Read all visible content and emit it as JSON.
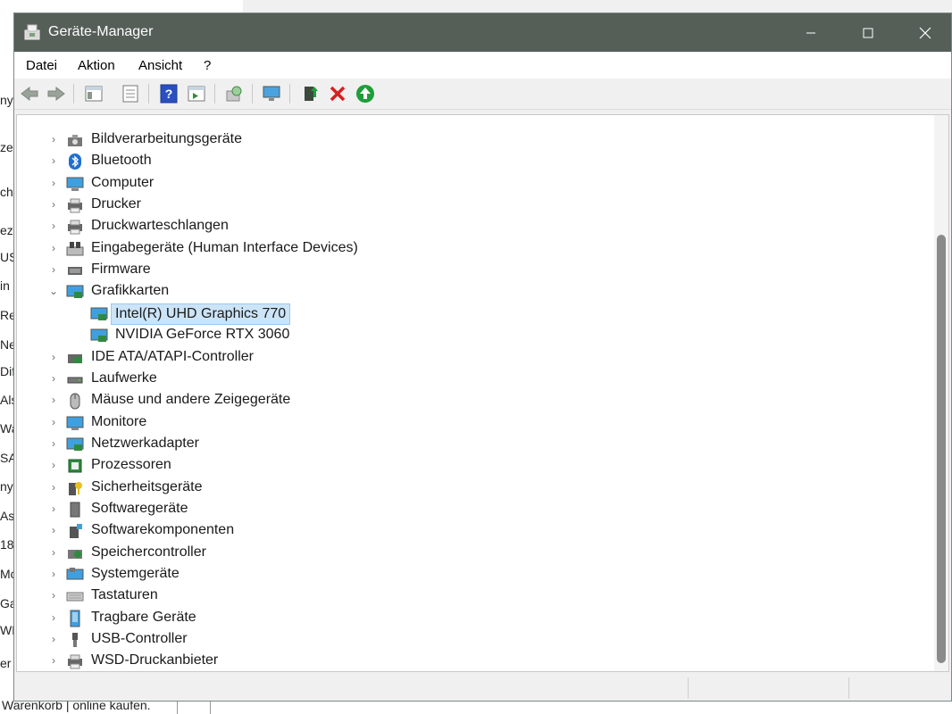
{
  "background": {
    "left_fragments": [
      "ny",
      "ze",
      "ch",
      "eze",
      "US",
      "in",
      "Rev",
      "Ne",
      "Dif",
      "Als",
      "Wai",
      "SA",
      "ny",
      "Ast",
      "18",
      "Mc",
      "Gar",
      "WD",
      "er"
    ],
    "bottom_text": "Warenkorb | online kaufen."
  },
  "window": {
    "title": "Geräte-Manager",
    "controls": {
      "minimize": "—",
      "maximize": "☐",
      "close": "✕"
    }
  },
  "menu": [
    "Datei",
    "Aktion",
    "Ansicht",
    "?"
  ],
  "toolbar": [
    "back-icon",
    "forward-icon",
    "show-hide-console-tree-icon",
    "properties-icon",
    "help-icon",
    "action-pane-icon",
    "scan-hardware-icon",
    "computer-monitor-icon",
    "update-driver-icon",
    "uninstall-device-icon",
    "enable-device-icon"
  ],
  "tree": [
    {
      "label": "Bildverarbeitungsgeräte",
      "icon": "camera-icon",
      "level": 0,
      "expander": "›"
    },
    {
      "label": "Bluetooth",
      "icon": "bluetooth-icon",
      "level": 0,
      "expander": "›"
    },
    {
      "label": "Computer",
      "icon": "computer-icon",
      "level": 0,
      "expander": "›"
    },
    {
      "label": "Drucker",
      "icon": "printer-icon",
      "level": 0,
      "expander": "›"
    },
    {
      "label": "Druckwarteschlangen",
      "icon": "print-queue-icon",
      "level": 0,
      "expander": "›"
    },
    {
      "label": "Eingabegeräte (Human Interface Devices)",
      "icon": "hid-icon",
      "level": 0,
      "expander": "›"
    },
    {
      "label": "Firmware",
      "icon": "firmware-icon",
      "level": 0,
      "expander": "›"
    },
    {
      "label": "Grafikkarten",
      "icon": "display-adapter-icon",
      "level": 0,
      "expander": "⌄"
    },
    {
      "label": "Intel(R) UHD Graphics 770",
      "icon": "display-adapter-device-icon",
      "level": 1,
      "selected": true
    },
    {
      "label": "NVIDIA GeForce RTX 3060",
      "icon": "display-adapter-device-icon",
      "level": 1
    },
    {
      "label": "IDE ATA/ATAPI-Controller",
      "icon": "ide-controller-icon",
      "level": 0,
      "expander": "›"
    },
    {
      "label": "Laufwerke",
      "icon": "disk-drive-icon",
      "level": 0,
      "expander": "›"
    },
    {
      "label": "Mäuse und andere Zeigegeräte",
      "icon": "mouse-icon",
      "level": 0,
      "expander": "›"
    },
    {
      "label": "Monitore",
      "icon": "monitor-icon",
      "level": 0,
      "expander": "›"
    },
    {
      "label": "Netzwerkadapter",
      "icon": "network-adapter-icon",
      "level": 0,
      "expander": "›"
    },
    {
      "label": "Prozessoren",
      "icon": "processor-icon",
      "level": 0,
      "expander": "›"
    },
    {
      "label": "Sicherheitsgeräte",
      "icon": "security-device-icon",
      "level": 0,
      "expander": "›"
    },
    {
      "label": "Softwaregeräte",
      "icon": "software-device-icon",
      "level": 0,
      "expander": "›"
    },
    {
      "label": "Softwarekomponenten",
      "icon": "software-component-icon",
      "level": 0,
      "expander": "›"
    },
    {
      "label": "Speichercontroller",
      "icon": "storage-controller-icon",
      "level": 0,
      "expander": "›"
    },
    {
      "label": "Systemgeräte",
      "icon": "system-device-icon",
      "level": 0,
      "expander": "›"
    },
    {
      "label": "Tastaturen",
      "icon": "keyboard-icon",
      "level": 0,
      "expander": "›"
    },
    {
      "label": "Tragbare Geräte",
      "icon": "portable-device-icon",
      "level": 0,
      "expander": "›"
    },
    {
      "label": "USB-Controller",
      "icon": "usb-icon",
      "level": 0,
      "expander": "›"
    },
    {
      "label": "WSD-Druckanbieter",
      "icon": "wsd-printer-icon",
      "level": 0,
      "expander": "›"
    }
  ],
  "colors": {
    "titlebar": "#565e58",
    "selection": "#cce4f7",
    "help_blue": "#2a4fbf",
    "delete_red": "#d62020",
    "enable_green": "#1e9e3a"
  }
}
